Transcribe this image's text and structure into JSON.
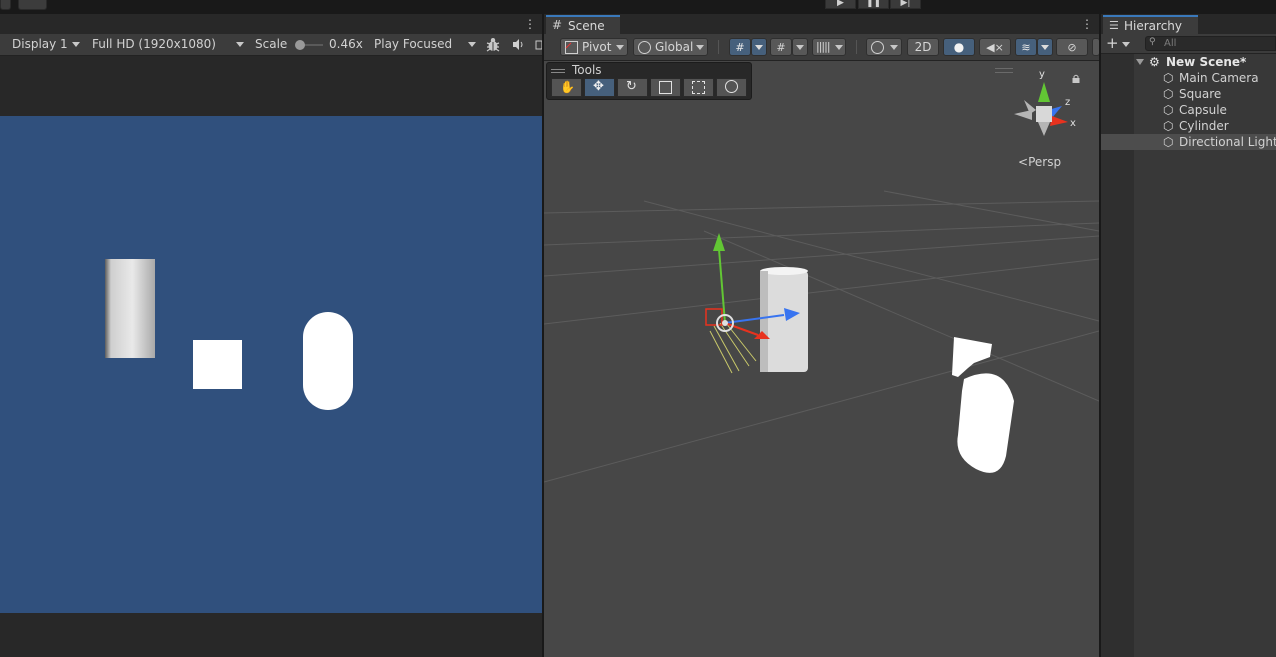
{
  "toolbar_top": {
    "play_icon": "play-icon",
    "pause_icon": "pause-icon",
    "step_icon": "step-icon"
  },
  "game": {
    "display": "Display 1",
    "resolution": "Full HD (1920x1080)",
    "scale_label": "Scale",
    "scale_value": "0.46x",
    "play_mode": "Play Focused",
    "canvas_color": "#30507d"
  },
  "scene": {
    "tab_label": "Scene",
    "pivot_label": "Pivot",
    "global_label": "Global",
    "mode_2d_label": "2D",
    "tools_title": "Tools",
    "tools": [
      "hand",
      "move",
      "rotate",
      "scale",
      "rect",
      "transform"
    ],
    "active_tool": "move",
    "persp_label": "Persp",
    "gizmo_axes": {
      "y": "y",
      "z": "z",
      "x": "x"
    },
    "colors": {
      "x_axis": "#e8321e",
      "y_axis": "#62c634",
      "z_axis": "#3874f0",
      "accent": "#46607c"
    }
  },
  "hierarchy": {
    "tab_label": "Hierarchy",
    "search_placeholder": "All",
    "scene_name": "New Scene*",
    "items": [
      {
        "label": "Main Camera"
      },
      {
        "label": "Square"
      },
      {
        "label": "Capsule"
      },
      {
        "label": "Cylinder"
      },
      {
        "label": "Directional Light",
        "selected": true
      }
    ]
  }
}
